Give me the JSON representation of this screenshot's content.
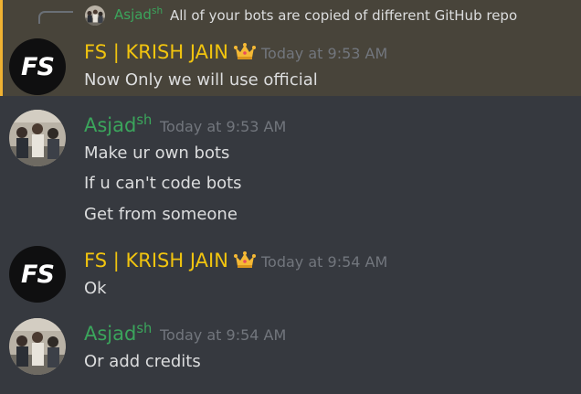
{
  "reply": {
    "author": "Asjad",
    "author_sup": "sh",
    "text": "All of your bots are copied of different GitHub repo"
  },
  "messages": [
    {
      "author": "FS | KRISH JAIN",
      "author_sup": "",
      "role_color": "#f1c40f",
      "badge": "crown-icon",
      "avatar": "fs-logo",
      "avatar_text": "FS",
      "timestamp": "Today at 9:53 AM",
      "lines": [
        "Now Only we will use official"
      ],
      "highlighted": true
    },
    {
      "author": "Asjad",
      "author_sup": "sh",
      "role_color": "#3ba55c",
      "avatar": "photo",
      "timestamp": "Today at 9:53 AM",
      "lines": [
        "Make ur own bots",
        "If u can't code bots",
        "Get from someone"
      ]
    },
    {
      "author": "FS | KRISH JAIN",
      "author_sup": "",
      "role_color": "#f1c40f",
      "badge": "crown-icon",
      "avatar": "fs-logo",
      "avatar_text": "FS",
      "timestamp": "Today at 9:54 AM",
      "lines": [
        "Ok"
      ]
    },
    {
      "author": "Asjad",
      "author_sup": "sh",
      "role_color": "#3ba55c",
      "avatar": "photo",
      "timestamp": "Today at 9:54 AM",
      "lines": [
        "Or add credits"
      ]
    }
  ],
  "colors": {
    "background": "#36393f",
    "highlight": "#48443a",
    "highlight_bar": "#f0b232",
    "text": "#dcddde",
    "timestamp": "#72767d"
  }
}
